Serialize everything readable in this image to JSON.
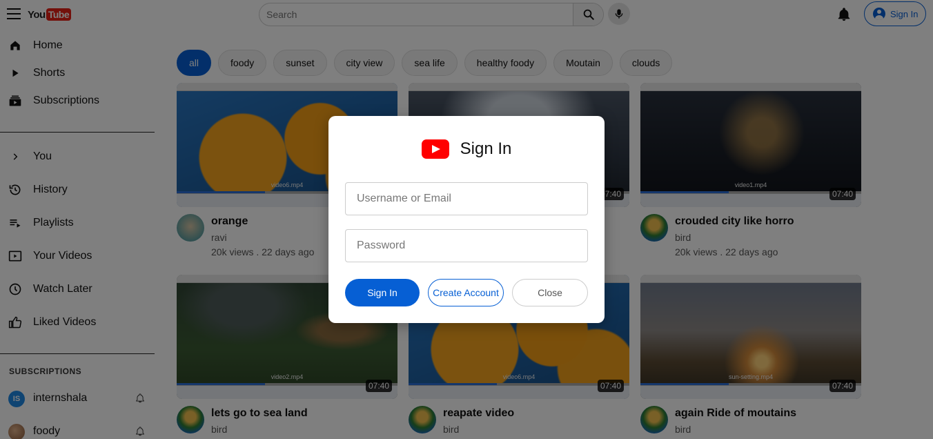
{
  "header": {
    "logo_you": "You",
    "logo_tube": "Tube",
    "search_placeholder": "Search",
    "signin_label": "Sign In"
  },
  "sidebar": {
    "main_items": [
      {
        "label": "Home",
        "icon": "home-icon"
      },
      {
        "label": "Shorts",
        "icon": "play-icon"
      },
      {
        "label": "Subscriptions",
        "icon": "subscriptions-icon"
      }
    ],
    "you_items": [
      {
        "label": "You",
        "icon": "chevron-right-icon"
      },
      {
        "label": "History",
        "icon": "history-icon"
      },
      {
        "label": "Playlists",
        "icon": "playlist-icon"
      },
      {
        "label": "Your Videos",
        "icon": "your-videos-icon"
      },
      {
        "label": "Watch Later",
        "icon": "clock-icon"
      },
      {
        "label": "Liked Videos",
        "icon": "thumbs-up-icon"
      }
    ],
    "subscriptions_heading": "SUBSCRIPTIONS",
    "subscriptions": [
      {
        "name": "internshala",
        "avatar_text": "IS",
        "avatar_color": "#1e88e5"
      },
      {
        "name": "foody",
        "avatar_text": "",
        "avatar_color": "#c98a5a"
      }
    ]
  },
  "chips": [
    {
      "label": "all",
      "active": true
    },
    {
      "label": "foody"
    },
    {
      "label": "sunset"
    },
    {
      "label": "city view"
    },
    {
      "label": "sea life"
    },
    {
      "label": "healthy foody"
    },
    {
      "label": "Moutain"
    },
    {
      "label": "clouds"
    }
  ],
  "videos": [
    {
      "title": "orange",
      "channel": "ravi",
      "stats": "20k views . 22 days ago",
      "duration": "",
      "file": "video6.mp4"
    },
    {
      "title": "",
      "channel": "",
      "stats": "",
      "duration": "07:40",
      "file": ""
    },
    {
      "title": "crouded city like horro",
      "channel": "bird",
      "stats": "20k views . 22 days ago",
      "duration": "07:40",
      "file": "video1.mp4"
    },
    {
      "title": "lets go to sea land",
      "channel": "bird",
      "stats": "",
      "duration": "07:40",
      "file": "video2.mp4"
    },
    {
      "title": "reapate video",
      "channel": "bird",
      "stats": "",
      "duration": "07:40",
      "file": "video6.mp4"
    },
    {
      "title": "again Ride of moutains",
      "channel": "bird",
      "stats": "",
      "duration": "07:40",
      "file": "sun-setting.mp4"
    }
  ],
  "modal": {
    "title": "Sign In",
    "username_placeholder": "Username or Email",
    "password_placeholder": "Password",
    "signin_button": "Sign In",
    "create_account_button": "Create Account",
    "close_button": "Close"
  },
  "colors": {
    "accent": "#065fd4",
    "youtube_red": "#ff0000",
    "overlay": "rgba(0,0,0,0.5)"
  }
}
